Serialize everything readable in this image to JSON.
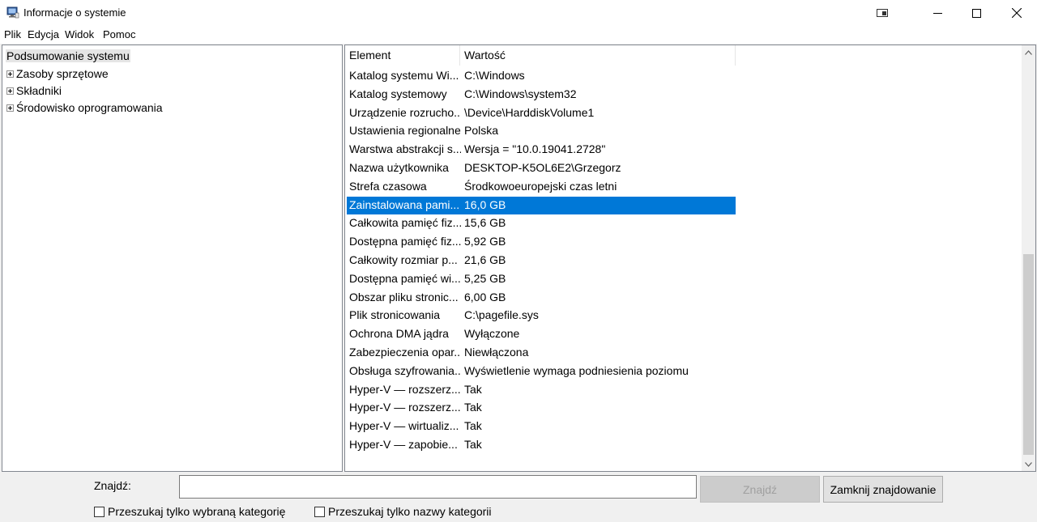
{
  "window": {
    "title": "Informacje o systemie"
  },
  "menu": {
    "items": [
      "Plik",
      "Edycja",
      "Widok",
      "Pomoc"
    ]
  },
  "tree": {
    "root": "Podsumowanie systemu",
    "children": [
      "Zasoby sprzętowe",
      "Składniki",
      "Środowisko oprogramowania"
    ]
  },
  "list": {
    "headers": [
      "Element",
      "Wartość"
    ],
    "rows": [
      {
        "element": "Katalog systemu Wi...",
        "value": "C:\\Windows"
      },
      {
        "element": "Katalog systemowy",
        "value": "C:\\Windows\\system32"
      },
      {
        "element": "Urządzenie rozrucho...",
        "value": "\\Device\\HarddiskVolume1"
      },
      {
        "element": "Ustawienia regionalne",
        "value": "Polska"
      },
      {
        "element": "Warstwa abstrakcji s...",
        "value": "Wersja = \"10.0.19041.2728\""
      },
      {
        "element": "Nazwa użytkownika",
        "value": "DESKTOP-K5OL6E2\\Grzegorz"
      },
      {
        "element": "Strefa czasowa",
        "value": "Środkowoeuropejski czas letni"
      },
      {
        "element": "Zainstalowana pami...",
        "value": "16,0 GB"
      },
      {
        "element": "Całkowita pamięć fiz...",
        "value": "15,6 GB"
      },
      {
        "element": "Dostępna pamięć fiz...",
        "value": "5,92 GB"
      },
      {
        "element": "Całkowity rozmiar p...",
        "value": "21,6 GB"
      },
      {
        "element": "Dostępna pamięć wi...",
        "value": "5,25 GB"
      },
      {
        "element": "Obszar pliku stronic...",
        "value": "6,00 GB"
      },
      {
        "element": "Plik stronicowania",
        "value": "C:\\pagefile.sys"
      },
      {
        "element": "Ochrona DMA jądra",
        "value": "Wyłączone"
      },
      {
        "element": "Zabezpieczenia opar...",
        "value": "Niewłączona"
      },
      {
        "element": "Obsługa szyfrowania...",
        "value": "Wyświetlenie wymaga podniesienia poziomu"
      },
      {
        "element": "Hyper-V — rozszerz...",
        "value": "Tak"
      },
      {
        "element": "Hyper-V — rozszerz...",
        "value": "Tak"
      },
      {
        "element": "Hyper-V — wirtualiz...",
        "value": "Tak"
      },
      {
        "element": "Hyper-V — zapobie...",
        "value": "Tak"
      }
    ],
    "selected_row_index": 7
  },
  "find": {
    "label": "Znajdź:",
    "input_value": "",
    "find_button": "Znajdź",
    "close_button": "Zamknij znajdowanie",
    "checkbox_selected_category": "Przeszukaj tylko wybraną kategorię",
    "checkbox_category_names": "Przeszukaj tylko nazwy kategorii"
  },
  "colors": {
    "selection": "#0078d7"
  }
}
